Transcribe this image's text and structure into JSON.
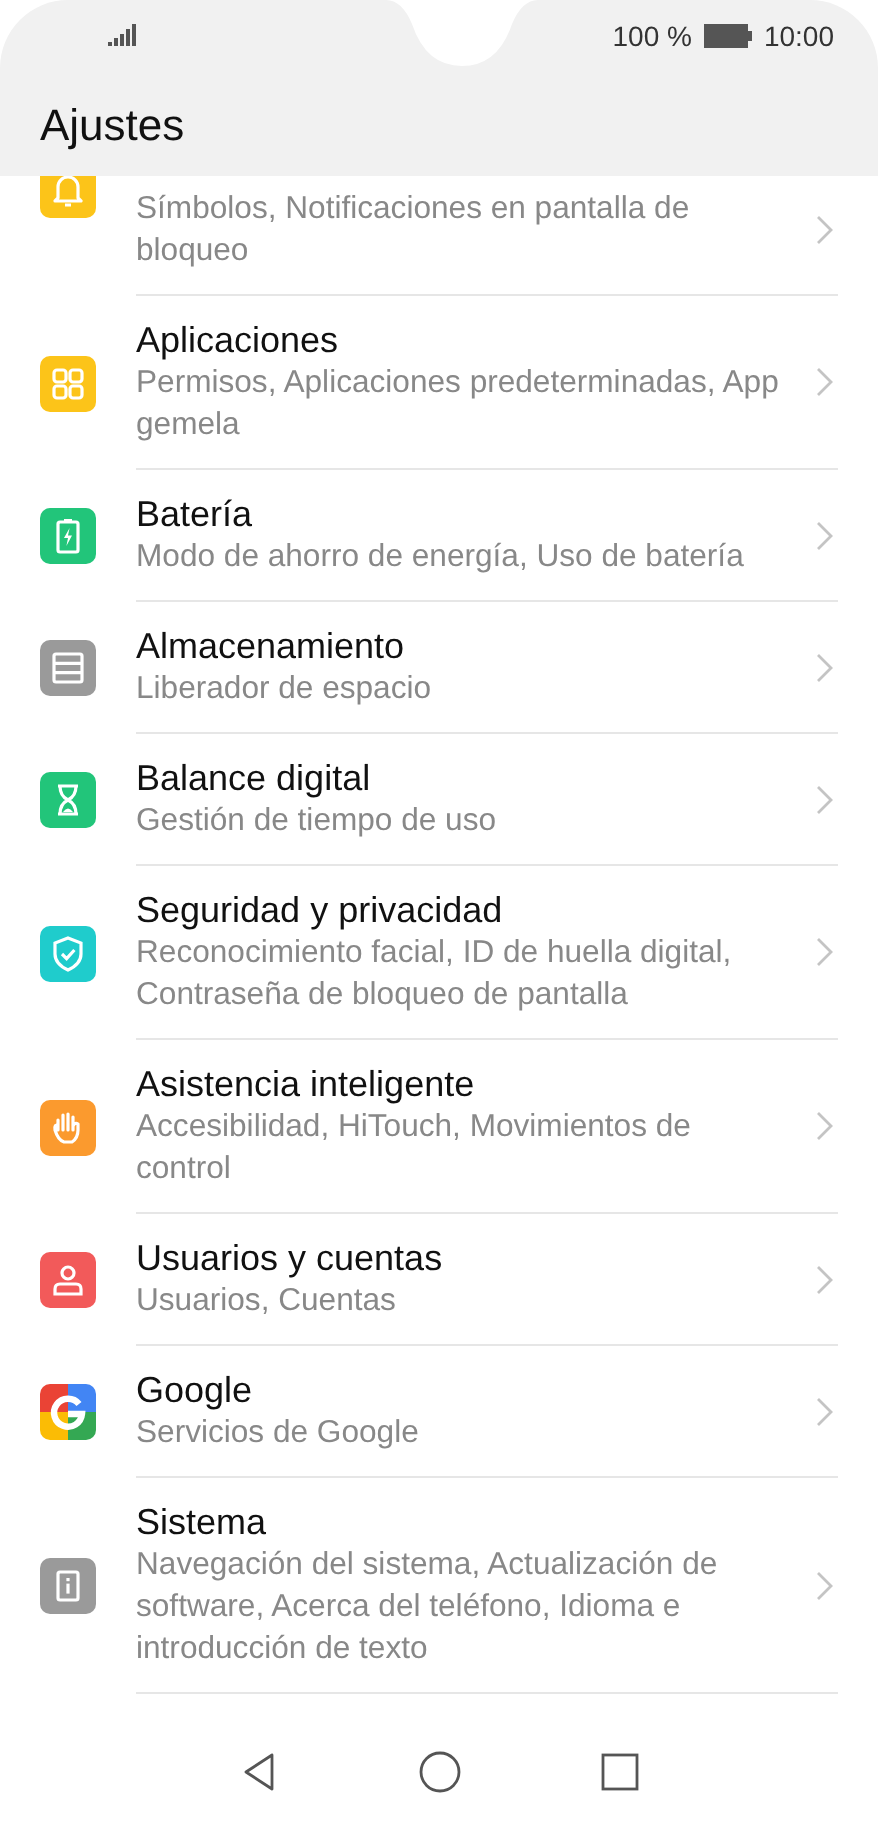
{
  "status_bar": {
    "battery_percent": "100 %",
    "time": "10:00"
  },
  "header": {
    "title": "Ajustes"
  },
  "items": [
    {
      "kind": "bell",
      "color": "#fcc419",
      "subtitle": "Símbolos, Notificaciones en pantalla de bloqueo"
    },
    {
      "kind": "apps",
      "color": "#fcc419",
      "title": "Aplicaciones",
      "subtitle": "Permisos, Aplicaciones predeterminadas, App gemela"
    },
    {
      "kind": "battery",
      "color": "#22c57a",
      "title": "Batería",
      "subtitle": "Modo de ahorro de energía, Uso de batería"
    },
    {
      "kind": "storage",
      "color": "#9a9a9a",
      "title": "Almacenamiento",
      "subtitle": "Liberador de espacio"
    },
    {
      "kind": "hourglass",
      "color": "#22c57a",
      "title": "Balance digital",
      "subtitle": "Gestión de tiempo de uso"
    },
    {
      "kind": "shield",
      "color": "#1fcccc",
      "title": "Seguridad y privacidad",
      "subtitle": "Reconocimiento facial, ID de huella digital, Contraseña de bloqueo de pantalla"
    },
    {
      "kind": "hand",
      "color": "#fb9a2e",
      "title": "Asistencia inteligente",
      "subtitle": "Accesibilidad, HiTouch, Movimientos de control"
    },
    {
      "kind": "user",
      "color": "#f25a5a",
      "title": "Usuarios y cuentas",
      "subtitle": "Usuarios, Cuentas"
    },
    {
      "kind": "google",
      "title": "Google",
      "subtitle": "Servicios de Google"
    },
    {
      "kind": "info",
      "color": "#9a9a9a",
      "title": "Sistema",
      "subtitle": "Navegación del sistema, Actualización de software, Acerca del teléfono, Idioma e introducción de texto"
    }
  ]
}
